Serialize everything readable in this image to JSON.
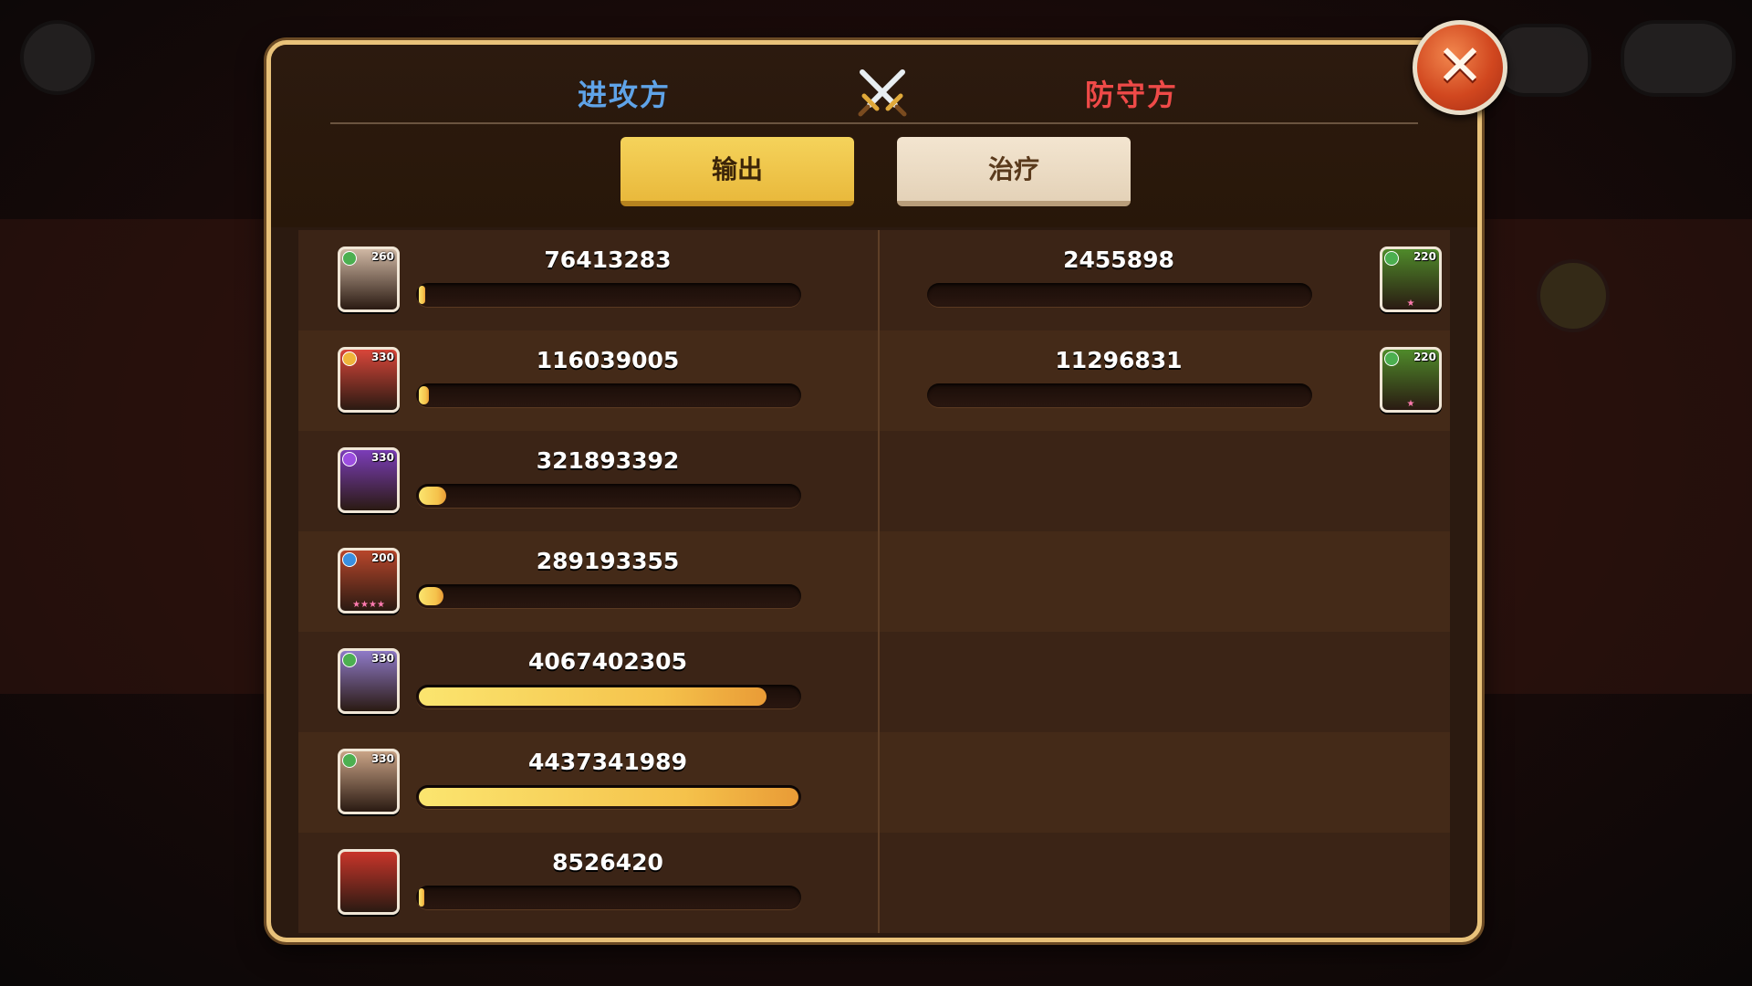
{
  "header": {
    "attack_label": "进攻方",
    "defend_label": "防守方"
  },
  "tabs": [
    {
      "label": "输出",
      "active": true
    },
    {
      "label": "治疗",
      "active": false
    }
  ],
  "close_label": "✕",
  "attackers": [
    {
      "level": "260",
      "stars": "",
      "value": "76413283",
      "fill_fraction": 0.017,
      "portrait_color": "#cfb7a3",
      "element_color": "#4caf50"
    },
    {
      "level": "330",
      "stars": "",
      "value": "116039005",
      "fill_fraction": 0.026,
      "portrait_color": "#d9463a",
      "element_color": "#f0b43a"
    },
    {
      "level": "330",
      "stars": "",
      "value": "321893392",
      "fill_fraction": 0.073,
      "portrait_color": "#7b3db8",
      "element_color": "#9c4ee0"
    },
    {
      "level": "200",
      "stars": "★★★★",
      "value": "289193355",
      "fill_fraction": 0.065,
      "portrait_color": "#b8462b",
      "element_color": "#3a8fe0"
    },
    {
      "level": "330",
      "stars": "",
      "value": "4067402305",
      "fill_fraction": 0.917,
      "portrait_color": "#8f7ac8",
      "element_color": "#4caf50"
    },
    {
      "level": "330",
      "stars": "",
      "value": "4437341989",
      "fill_fraction": 1.0,
      "portrait_color": "#c9a386",
      "element_color": "#4caf50"
    },
    {
      "level": "",
      "stars": "",
      "value": "8526420",
      "fill_fraction": 0.002,
      "portrait_color": "#c8352a",
      "element_color": ""
    }
  ],
  "defenders": [
    {
      "level": "220",
      "stars": "★",
      "value": "2455898",
      "fill_fraction": 0.0,
      "portrait_color": "#4f8a2a",
      "element_color": "#4caf50"
    },
    {
      "level": "220",
      "stars": "★",
      "value": "11296831",
      "fill_fraction": 0.0,
      "portrait_color": "#4f8a2a",
      "element_color": "#4caf50"
    }
  ],
  "colors": {
    "attack_accent": "#5fa3e8",
    "defend_accent": "#ef4a48",
    "bar_fill": "#f5c24b",
    "panel_border": "#e9c27a"
  }
}
